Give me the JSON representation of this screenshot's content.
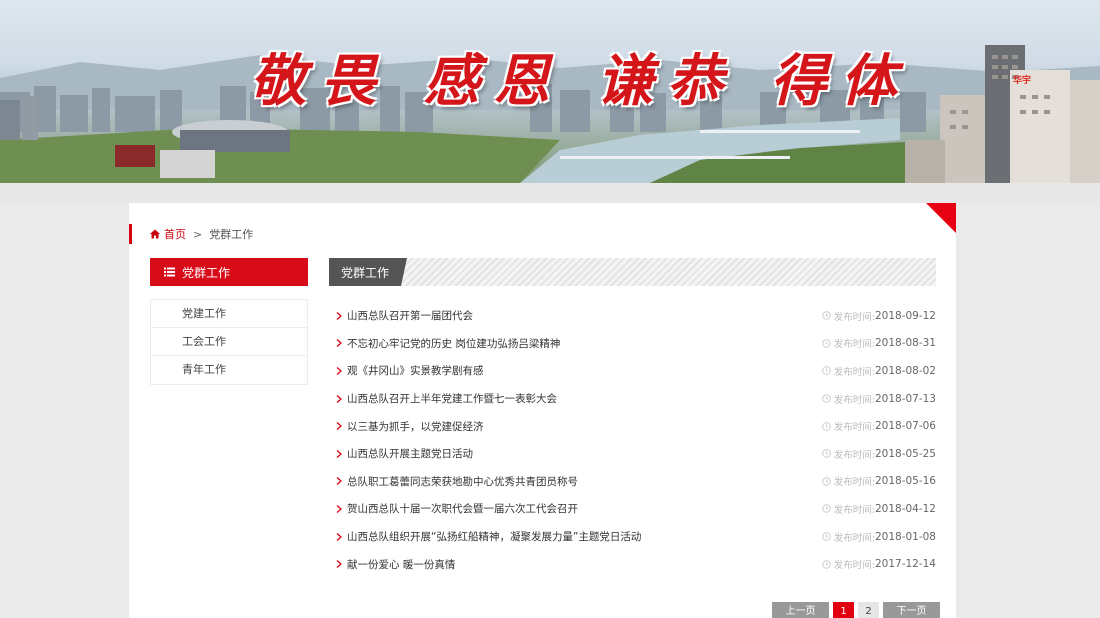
{
  "banner": {
    "slogan": "敬畏 感恩 谦恭 得体",
    "building_sign": "华宇"
  },
  "breadcrumb": {
    "home": "首页",
    "separator": ">",
    "current": "党群工作"
  },
  "sidebar": {
    "title": "党群工作",
    "items": [
      {
        "label": "党建工作"
      },
      {
        "label": "工会工作"
      },
      {
        "label": "青年工作"
      }
    ]
  },
  "content": {
    "tab": "党群工作",
    "date_label": "发布时间:",
    "news": [
      {
        "title": "山西总队召开第一届团代会",
        "date": "2018-09-12"
      },
      {
        "title": "不忘初心牢记党的历史 岗位建功弘扬吕梁精神",
        "date": "2018-08-31"
      },
      {
        "title": "观《井冈山》实景教学剧有感",
        "date": "2018-08-02"
      },
      {
        "title": "山西总队召开上半年党建工作暨七一表彰大会",
        "date": "2018-07-13"
      },
      {
        "title": "以三基为抓手，以党建促经济",
        "date": "2018-07-06"
      },
      {
        "title": "山西总队开展主题党日活动",
        "date": "2018-05-25"
      },
      {
        "title": "总队职工葛蕾同志荣获地勘中心优秀共青团员称号",
        "date": "2018-05-16"
      },
      {
        "title": "贺山西总队十届一次职代会暨一届六次工代会召开",
        "date": "2018-04-12"
      },
      {
        "title": "山西总队组织开展“弘扬红船精神，凝聚发展力量”主题党日活动",
        "date": "2018-01-08"
      },
      {
        "title": "献一份爱心 暖一份真情",
        "date": "2017-12-14"
      }
    ]
  },
  "pager": {
    "prev": "上一页",
    "pages": [
      "1",
      "2"
    ],
    "current": "1",
    "next": "下一页"
  },
  "colors": {
    "accent_red": "#d80c18",
    "tab_gray": "#555555",
    "page_bg": "#eaeaea"
  }
}
